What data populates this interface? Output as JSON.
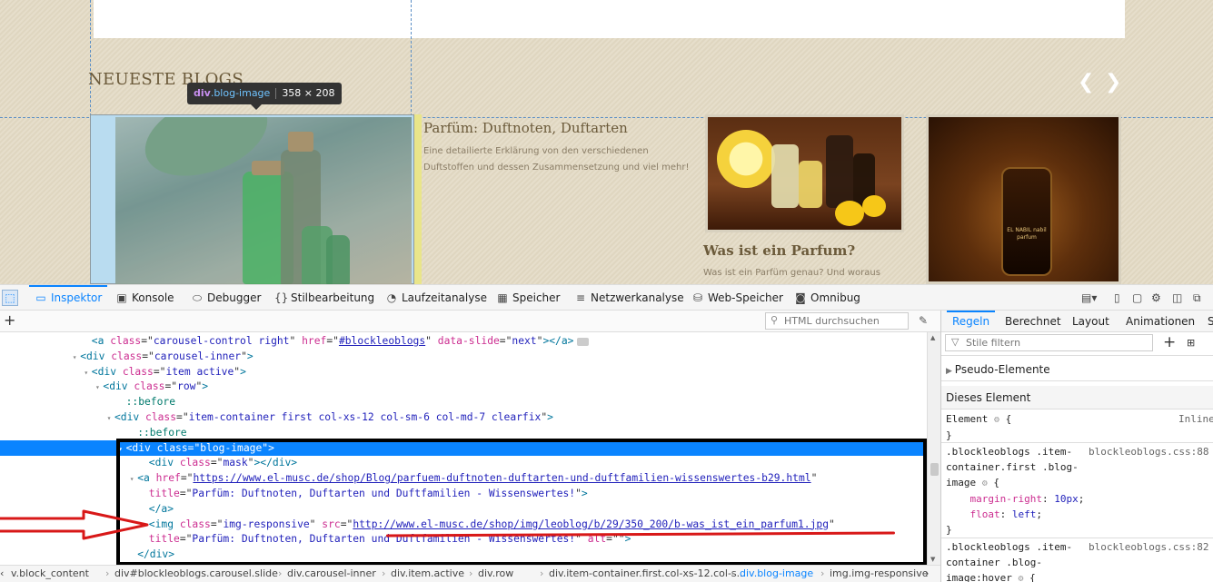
{
  "page": {
    "section_title": "NEUESTE BLOGS",
    "carousel_prev": "❮",
    "carousel_next": "❯",
    "posts": [
      {
        "title": "Parfüm: Duftnoten, Duftarten",
        "text1": "Eine detailierte Erklärung von den verschiedenen",
        "text2": "Duftstoffen und dessen Zusammensetzung und viel mehr!"
      },
      {
        "title": "Was ist ein Parfum?",
        "text1": "Was ist ein Parfüm genau? Und woraus"
      }
    ],
    "perfume_label": "EL NABIL\nnabil parfum"
  },
  "tooltip": {
    "tag": "div",
    "cls": ".blog-image",
    "size": "358 × 208"
  },
  "toolbar": {
    "tabs": [
      "Inspektor",
      "Konsole",
      "Debugger",
      "Stilbearbeitung",
      "Laufzeitanalyse",
      "Speicher",
      "Netzwerkanalyse",
      "Web-Speicher",
      "Omnibug"
    ],
    "icons": [
      "picker-icon",
      "inspector-icon",
      "console-icon",
      "debugger-icon",
      "style-editor-icon",
      "performance-icon",
      "memory-icon",
      "network-icon",
      "storage-icon",
      "omnibug-icon"
    ]
  },
  "markup": {
    "search_placeholder": "HTML durchsuchen",
    "lines": [
      {
        "indent": 8,
        "open": "<",
        "tag": "a",
        "attrs": [
          [
            "class",
            "carousel-control right"
          ],
          [
            "href",
            "#blockleoblogs"
          ],
          [
            "data-slide",
            "next"
          ]
        ],
        "close": "></a>",
        "ev": true
      },
      {
        "indent": 7,
        "twisty": "▾",
        "open": "<",
        "tag": "div",
        "attrs": [
          [
            "class",
            "carousel-inner"
          ]
        ],
        "close": ">"
      },
      {
        "indent": 8,
        "twisty": "▾",
        "open": "<",
        "tag": "div",
        "attrs": [
          [
            "class",
            "item active"
          ]
        ],
        "close": ">"
      },
      {
        "indent": 9,
        "twisty": "▾",
        "open": "<",
        "tag": "div",
        "attrs": [
          [
            "class",
            "row"
          ]
        ],
        "close": ">"
      },
      {
        "indent": 11,
        "pseudo": "::before"
      },
      {
        "indent": 10,
        "twisty": "▾",
        "open": "<",
        "tag": "div",
        "attrs": [
          [
            "class",
            "item-container first col-xs-12 col-sm-6 col-md-7 clearfix"
          ]
        ],
        "close": ">"
      },
      {
        "indent": 12,
        "pseudo": "::before"
      },
      {
        "indent": 11,
        "twisty": "▾",
        "open": "<",
        "tag": "div",
        "attrs": [
          [
            "class",
            "blog-image"
          ]
        ],
        "close": ">",
        "selected": true
      },
      {
        "indent": 13,
        "open": "<",
        "tag": "div",
        "attrs": [
          [
            "class",
            "mask"
          ]
        ],
        "close": "></div>"
      },
      {
        "indent": 12,
        "twisty": "▾",
        "open": "<",
        "tag": "a",
        "attrs": [
          [
            "href",
            "https://www.el-musc.de/shop/Blog/parfuem-duftnoten-duftarten-und-duftfamilien-wissenswertes-b29.html"
          ]
        ],
        "close": ""
      },
      {
        "indent": 13,
        "cont": true,
        "attrs": [
          [
            "title",
            "Parfüm: Duftnoten, Duftarten und Duftfamilien - Wissenswertes!"
          ]
        ],
        "close": ">"
      },
      {
        "indent": 13,
        "text": "</a>"
      },
      {
        "indent": 13,
        "open": "<",
        "tag": "img",
        "attrs": [
          [
            "class",
            "img-responsive"
          ],
          [
            "src",
            "http://www.el-musc.de/shop/img/leoblog/b/29/350_200/b-was_ist_ein_parfum1.jpg"
          ]
        ],
        "close": ""
      },
      {
        "indent": 13,
        "cont": true,
        "attrs": [
          [
            "title",
            "Parfüm: Duftnoten, Duftarten und Duftfamilien - Wissenswertes!"
          ],
          [
            "alt",
            ""
          ]
        ],
        "close": ">"
      },
      {
        "indent": 12,
        "text": "</div>"
      }
    ]
  },
  "breadcrumbs": [
    "v.block_content",
    "div#blockleoblogs.carousel.slide",
    "div.carousel-inner",
    "div.item.active",
    "div.row",
    "div.item-container.first.col-xs-12.col-s...",
    "div.blog-image",
    "img.img-responsive"
  ],
  "rules": {
    "tabs": [
      "Regeln",
      "Berechnet",
      "Layout",
      "Animationen",
      "S"
    ],
    "filter_placeholder": "Stile filtern",
    "pseudo_section": "Pseudo-Elemente",
    "element_section": "Dieses Element",
    "element_rule": "Element",
    "element_src": "Inline",
    "rule1_selector": [
      ".blockleoblogs .item-",
      "container.first .blog-",
      "image"
    ],
    "rule1_src": "blockleoblogs.css:88",
    "rule1_props": [
      [
        "margin-right",
        "10px"
      ],
      [
        "float",
        "left"
      ]
    ],
    "rule2_selector": [
      ".blockleoblogs .item-",
      "container .blog-",
      "image:hover"
    ],
    "rule2_src": "blockleoblogs.css:82"
  },
  "colors": {
    "accent": "#0a84ff",
    "selection": "#0a84ff",
    "annotation": "#d81818"
  }
}
